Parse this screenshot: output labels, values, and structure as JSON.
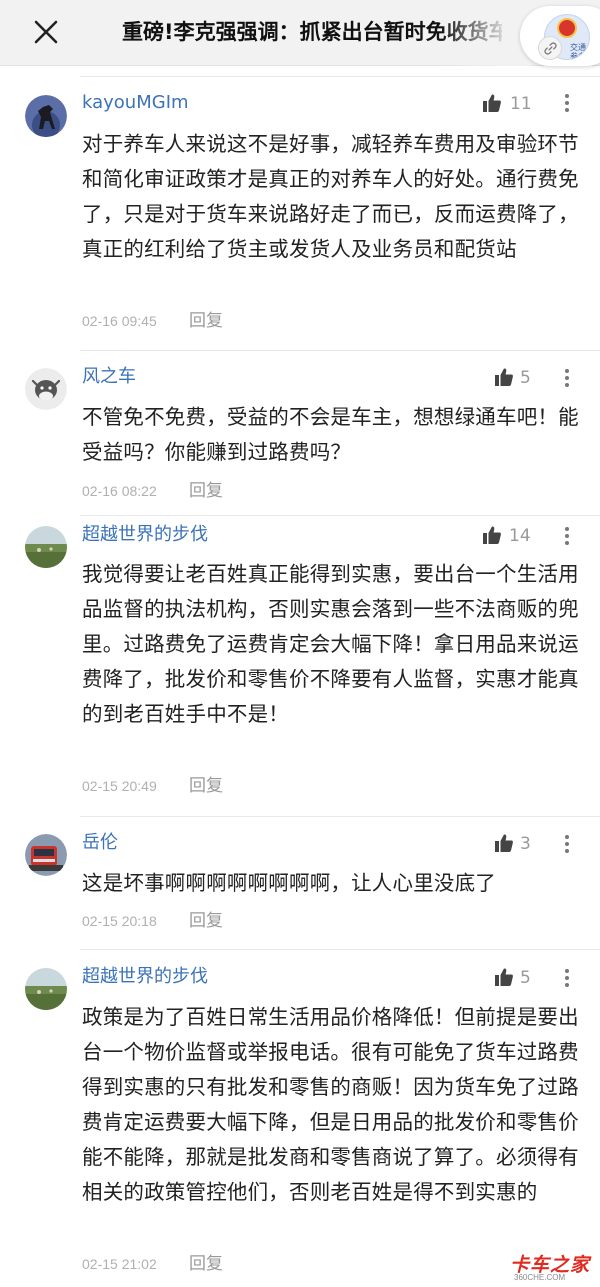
{
  "header": {
    "title": "重磅!李克强强调：抓紧出台暂时免收货车过路费"
  },
  "miniprogram_logo": {
    "name": "country-emblem-icon",
    "text": "交通 参考"
  },
  "comments": [
    {
      "username": "kayouMGIm",
      "likes": "11",
      "text": "对于养车人来说这不是好事，减轻养车费用及审验环节和简化审证政策才是真正的对养车人的好处。通行费免了，只是对于货车来说路好走了而已，反而运费降了，真正的红利给了货主或发货人及业务员和配货站",
      "time": "02-16 09:45",
      "reply_label": "回复",
      "avatar": "horse-avatar"
    },
    {
      "username": "风之车",
      "likes": "5",
      "text": "不管免不免费，受益的不会是车主，想想绿通车吧！能受益吗？你能赚到过路费吗？",
      "time": "02-16 08:22",
      "reply_label": "回复",
      "avatar": "cow-avatar"
    },
    {
      "username": "超越世界的步伐",
      "likes": "14",
      "text": "我觉得要让老百姓真正能得到实惠，要出台一个生活用品监督的执法机构，否则实惠会落到一些不法商贩的兜里。过路费免了运费肯定会大幅下降！拿日用品来说运费降了，批发价和零售价不降要有人监督，实惠才能真的到老百姓手中不是！",
      "time": "02-15 20:49",
      "reply_label": "回复",
      "avatar": "grassland-avatar"
    },
    {
      "username": "岳伦",
      "likes": "3",
      "text": "这是坏事啊啊啊啊啊啊啊啊，让人心里没底了",
      "time": "02-15 20:18",
      "reply_label": "回复",
      "avatar": "truck-avatar"
    },
    {
      "username": "超越世界的步伐",
      "likes": "5",
      "text": "政策是为了百姓日常生活用品价格降低！但前提是要出台一个物价监督或举报电话。很有可能免了货车过路费得到实惠的只有批发和零售的商贩！因为货车免了过路费肯定运费要大幅下降，但是日用品的批发价和零售价能不能降，那就是批发商和零售商说了算了。必须得有相关的政策管控他们，否则老百姓是得不到实惠的",
      "time": "02-15 21:02",
      "reply_label": "回复",
      "avatar": "grassland-avatar"
    }
  ],
  "watermark": {
    "main": "卡车之家",
    "sub": "360CHE.COM"
  }
}
